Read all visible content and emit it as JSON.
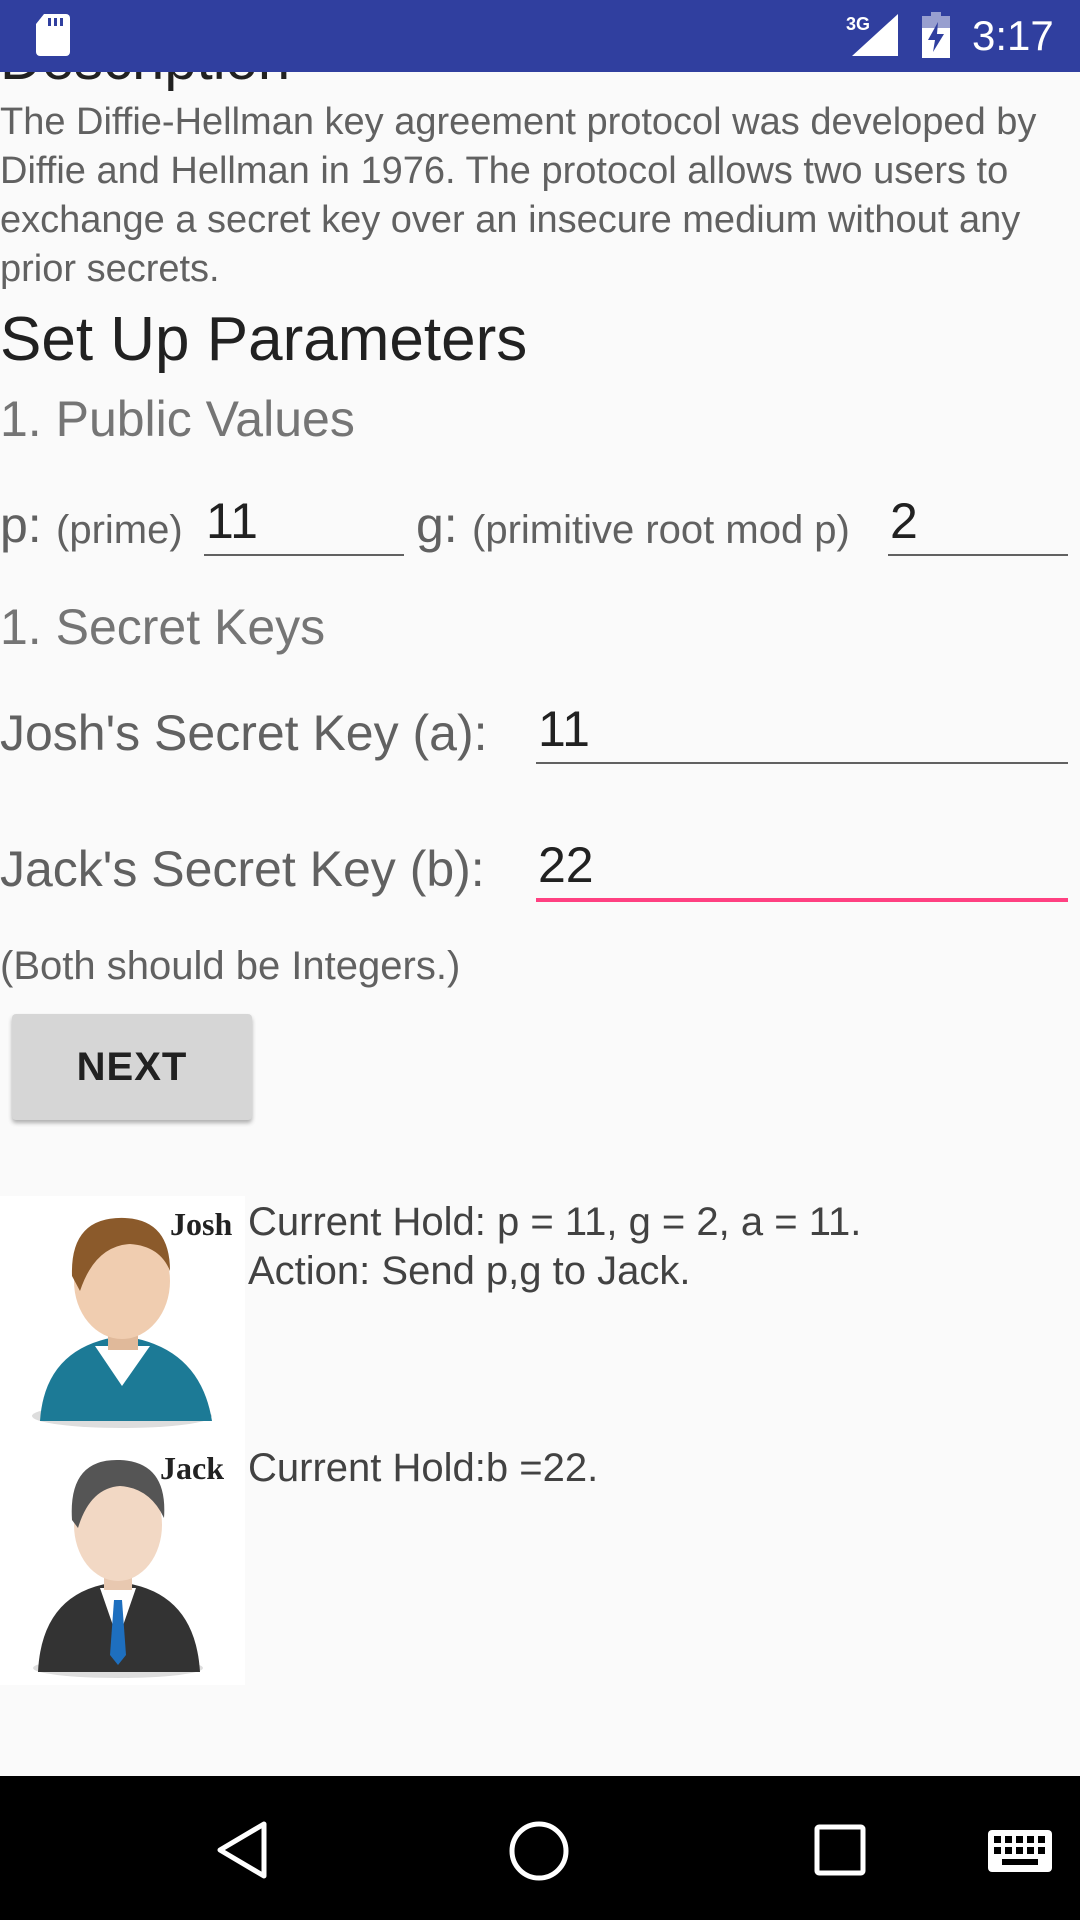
{
  "status_bar": {
    "network_type": "3G",
    "time": "3:17",
    "icons": [
      "sd-card-icon",
      "signal-icon",
      "battery-charging-icon"
    ]
  },
  "description": {
    "heading": "Description",
    "text": "The Diffie-Hellman key agreement protocol was developed by Diffie and Hellman in 1976. The protocol allows two users to exchange a secret key over an insecure medium without any prior secrets."
  },
  "setup": {
    "title": "Set Up Parameters",
    "public_values_label": "1. Public Values",
    "p_label": "p:",
    "p_sublabel": "(prime)",
    "p_value": "11",
    "g_label": "g:",
    "g_sublabel": "(primitive root mod p)",
    "g_value": "2",
    "secret_keys_label": "1. Secret Keys",
    "josh_label": "Josh's Secret Key (a):",
    "josh_value": "11",
    "jack_label": "Jack's Secret Key (b):",
    "jack_value": "22",
    "hint": "(Both should be Integers.)",
    "next_button": "NEXT"
  },
  "participants": {
    "josh": {
      "name": "Josh",
      "hold_line1": "Current Hold: p = 11, g = 2, a = 11.",
      "hold_line2": "Action: Send p,g to Jack."
    },
    "jack": {
      "name": "Jack",
      "hold_line1": "Current Hold:b =22."
    }
  },
  "nav_bar": {
    "buttons": [
      "back-icon",
      "home-icon",
      "recents-icon",
      "keyboard-icon"
    ]
  },
  "colors": {
    "status_bar": "#303f9f",
    "accent": "#ff4081",
    "background": "#fafafa"
  }
}
